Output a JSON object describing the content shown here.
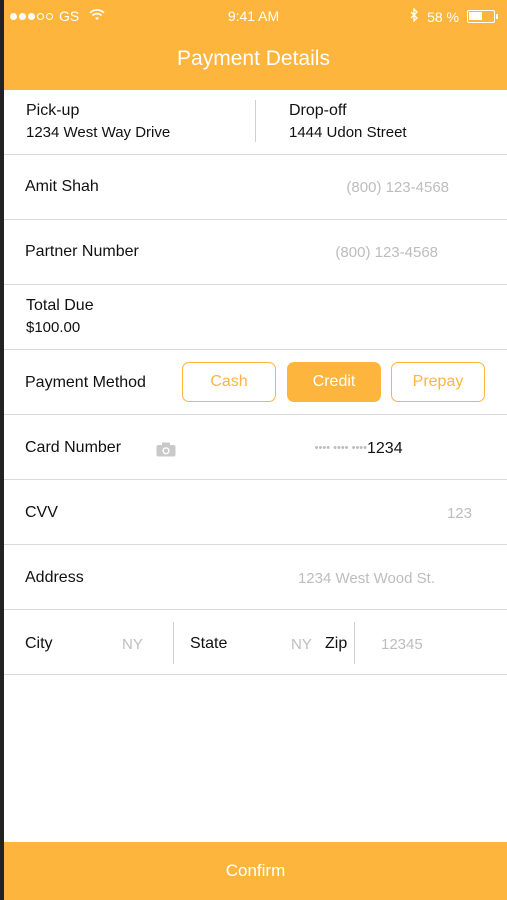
{
  "status_bar": {
    "carrier": "GS",
    "time": "9:41 AM",
    "battery": "58 %",
    "battery_level": 0.58,
    "icons": [
      "signal-dots-icon",
      "wifi-icon",
      "bluetooth-icon",
      "battery-icon"
    ]
  },
  "header": {
    "title": "Payment Details"
  },
  "route": {
    "pickup_label": "Pick-up",
    "pickup_address": "1234 West Way Drive",
    "dropoff_label": "Drop-off",
    "dropoff_address": "1444 Udon Street"
  },
  "contact": {
    "name": "Amit Shah",
    "phone": "(800) 123-4568"
  },
  "partner": {
    "label": "Partner Number",
    "phone": "(800) 123-4568"
  },
  "total": {
    "label": "Total Due",
    "amount": "$100.00"
  },
  "payment_method": {
    "label": "Payment Method",
    "options": [
      "Cash",
      "Credit",
      "Prepay"
    ],
    "selected": "Credit"
  },
  "card": {
    "label": "Card Number",
    "masked": "•••• •••• ••••",
    "last4": "1234"
  },
  "cvv": {
    "label": "CVV",
    "placeholder": "123"
  },
  "address": {
    "label": "Address",
    "placeholder": "1234 West Wood St."
  },
  "location": {
    "city_label": "City",
    "city_placeholder": "NY",
    "state_label": "State",
    "state_placeholder": "NY",
    "zip_label": "Zip",
    "zip_placeholder": "12345"
  },
  "footer": {
    "confirm_label": "Confirm"
  },
  "colors": {
    "accent": "#FEB53E",
    "divider": "#d9d9d9",
    "placeholder": "#bdbdbd"
  }
}
